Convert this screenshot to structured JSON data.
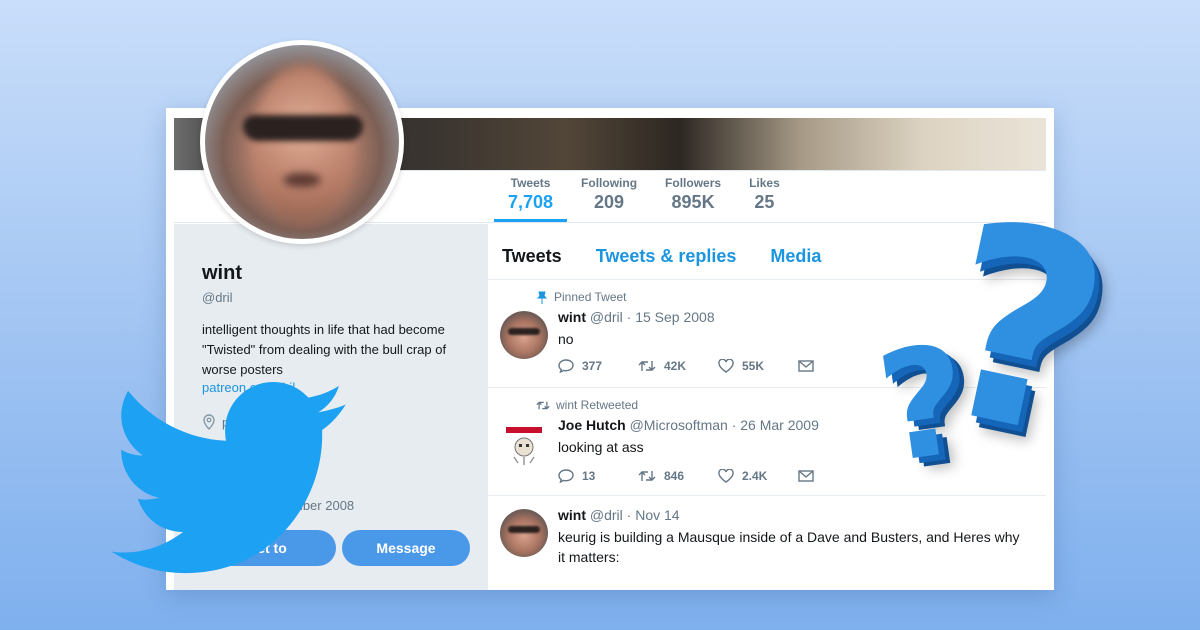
{
  "profile": {
    "name": "wint",
    "handle": "@dril",
    "bio": "intelligent thoughts in life that had become \"Twisted\" from dealing with the bull crap of worse posters",
    "link": "patreon.com/dril",
    "location_partial": "p",
    "extra_partial": "s",
    "joined_partial": "mber 2008",
    "tweet_to_label": "et to",
    "message_label": "Message"
  },
  "stats": [
    {
      "label": "Tweets",
      "value": "7,708"
    },
    {
      "label": "Following",
      "value": "209"
    },
    {
      "label": "Followers",
      "value": "895K"
    },
    {
      "label": "Likes",
      "value": "25"
    }
  ],
  "tabs": [
    "Tweets",
    "Tweets & replies",
    "Media"
  ],
  "tweets": [
    {
      "context": "Pinned Tweet",
      "name": "wint",
      "meta": "@dril · 15 Sep 2008",
      "text": "no",
      "replies": "377",
      "retweets": "42K",
      "likes": "55K"
    },
    {
      "context": "wint Retweeted",
      "name": "Joe Hutch",
      "meta": "@Microsoftman · 26 Mar 2009",
      "text": "looking at ass",
      "replies": "13",
      "retweets": "846",
      "likes": "2.4K"
    },
    {
      "context": "",
      "name": "wint",
      "meta": "@dril · Nov 14",
      "text": "keurig is building a Mausque inside of a Dave and Busters, and Heres why it matters:",
      "replies": "",
      "retweets": "",
      "likes": ""
    }
  ],
  "icons": {
    "pin": "pin-icon",
    "retweet": "retweet-icon",
    "reply": "reply-icon",
    "like": "heart-icon",
    "dm": "envelope-icon",
    "location": "location-icon",
    "logo": "twitter-bird-icon",
    "decor": "question-mark-icon"
  },
  "colors": {
    "accent": "#1da1f2",
    "link": "#1b95e0",
    "button": "#4a99e9",
    "bird": "#1da1f2",
    "question": "#2f8fe0"
  }
}
